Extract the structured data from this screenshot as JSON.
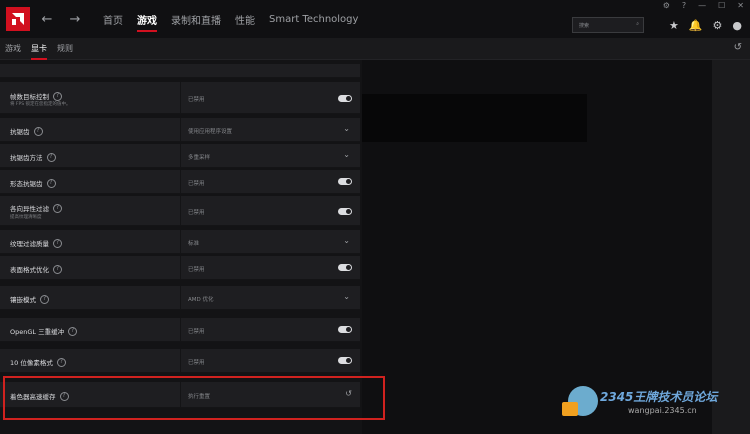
{
  "topbar": {
    "back": "←",
    "forward": "→",
    "tabs": [
      "首页",
      "游戏",
      "录制和直播",
      "性能",
      "Smart Technology"
    ],
    "active_tab": "游戏",
    "search_placeholder": "搜索"
  },
  "subbar": {
    "tabs": [
      "游戏",
      "显卡",
      "规则"
    ],
    "active": "显卡"
  },
  "settings": [
    {
      "label": "帧数目标控制",
      "sub": "将 FPS 锁定在您指定的值中。",
      "value": "已禁用",
      "control": "toggle"
    },
    {
      "label": "抗锯齿",
      "value": "使用应用程序设置",
      "control": "dropdown"
    },
    {
      "label": "抗锯齿方法",
      "value": "多重采样",
      "control": "dropdown"
    },
    {
      "label": "形态抗锯齿",
      "value": "已禁用",
      "control": "toggle"
    },
    {
      "label": "各向异性过滤",
      "sub": "提高纹理清晰度",
      "value": "已禁用",
      "control": "toggle"
    },
    {
      "label": "纹理过滤质量",
      "value": "标准",
      "control": "dropdown"
    },
    {
      "label": "表面格式优化",
      "value": "已禁用",
      "control": "toggle"
    },
    {
      "label": "镶嵌模式",
      "value": "AMD 优化",
      "control": "dropdown"
    },
    {
      "label": "OpenGL 三重缓冲",
      "value": "已禁用",
      "control": "toggle"
    },
    {
      "label": "10 位像素格式",
      "value": "已禁用",
      "control": "toggle"
    },
    {
      "label": "着色器高速缓存",
      "value": "执行重置",
      "control": "reset"
    }
  ],
  "watermark": {
    "title": "2345王牌技术员论坛",
    "url": "wangpai.2345.cn"
  }
}
